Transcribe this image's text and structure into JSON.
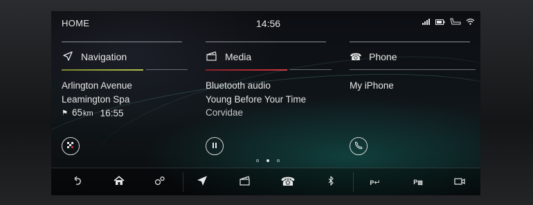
{
  "status": {
    "home_label": "HOME",
    "time": "14:56",
    "icons": [
      "signal-icon",
      "battery-icon",
      "seat-icon",
      "wifi-icon"
    ]
  },
  "panels": {
    "navigation": {
      "title": "Navigation",
      "icon": "navigation-arrow-icon",
      "line1": "Arlington Avenue",
      "line2": "Leamington Spa",
      "distance": "65",
      "distance_unit": "km",
      "eta": "16:55",
      "accent_color": "#a0b040",
      "button_icon": "destination-flag-icon"
    },
    "media": {
      "title": "Media",
      "icon": "media-clapper-icon",
      "source": "Bluetooth audio",
      "track": "Young Before Your Time",
      "artist": "Corvidae",
      "accent_color": "#c0303a",
      "button_icon": "pause-icon"
    },
    "phone": {
      "title": "Phone",
      "icon": "phone-icon",
      "device": "My iPhone",
      "button_icon": "call-icon"
    }
  },
  "pager": {
    "count": 3,
    "active": 2
  },
  "bottombar": {
    "buttons": [
      "back-icon",
      "home-icon",
      "connect-icon",
      "navigation-icon",
      "media-icon",
      "phone-icon",
      "bluetooth-icon",
      "park-assist-icon",
      "park-view-icon",
      "camera-icon"
    ]
  }
}
